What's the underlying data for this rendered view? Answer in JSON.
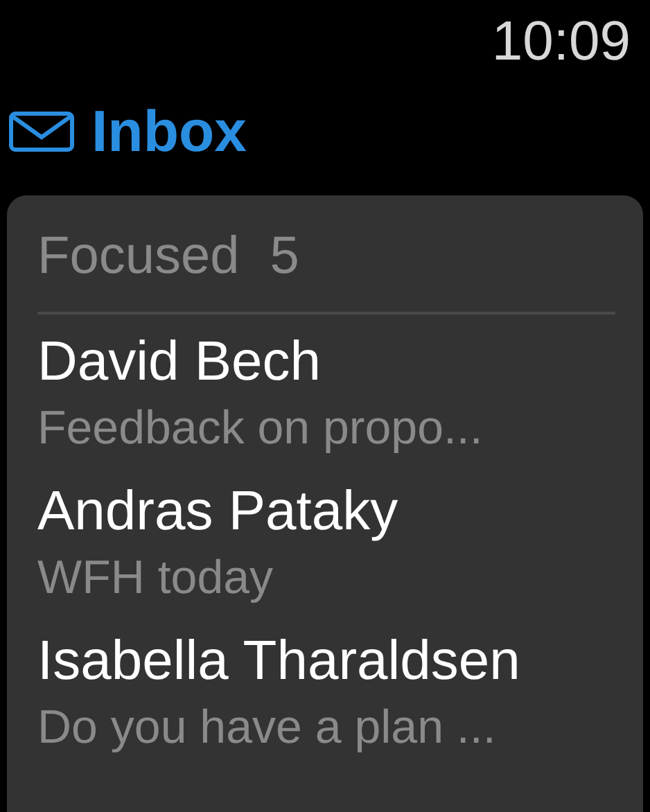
{
  "status_bar": {
    "time": "10:09"
  },
  "header": {
    "title": "Inbox"
  },
  "section": {
    "label": "Focused",
    "count": "5"
  },
  "messages": [
    {
      "sender": "David Bech",
      "subject": "Feedback on propo..."
    },
    {
      "sender": "Andras Pataky",
      "subject": "WFH today"
    },
    {
      "sender": "Isabella Tharaldsen",
      "subject": "Do you have a plan ..."
    }
  ]
}
